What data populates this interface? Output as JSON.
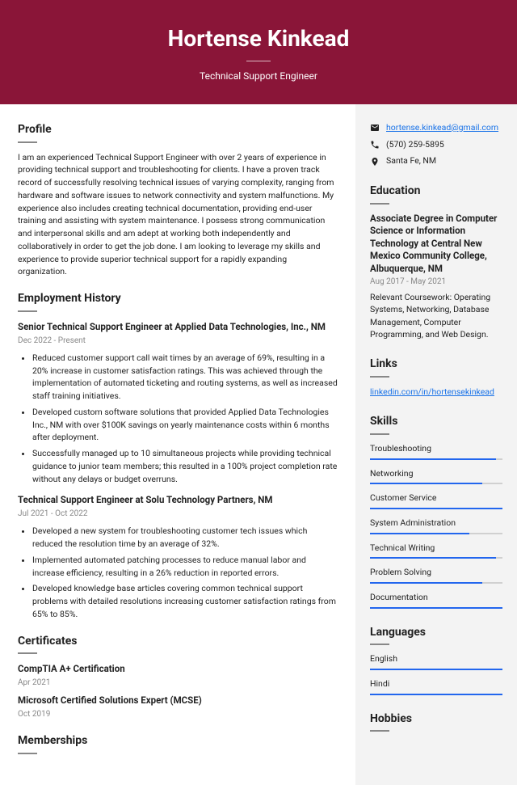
{
  "header": {
    "name": "Hortense Kinkead",
    "title": "Technical Support Engineer"
  },
  "profile": {
    "heading": "Profile",
    "text": "I am an experienced Technical Support Engineer with over 2 years of experience in providing technical support and troubleshooting for clients. I have a proven track record of successfully resolving technical issues of varying complexity, ranging from hardware and software issues to network connectivity and system malfunctions. My experience also includes creating technical documentation, providing end-user training and assisting with system maintenance. I possess strong communication and interpersonal skills and am adept at working both independently and collaboratively in order to get the job done. I am looking to leverage my skills and experience to provide superior technical support for a rapidly expanding organization."
  },
  "employment": {
    "heading": "Employment History",
    "jobs": [
      {
        "title": "Senior Technical Support Engineer at Applied Data Technologies, Inc., NM",
        "dates": "Dec 2022 - Present",
        "bullets": [
          "Reduced customer support call wait times by an average of 69%, resulting in a 20% increase in customer satisfaction ratings. This was achieved through the implementation of automated ticketing and routing systems, as well as increased staff training initiatives.",
          "Developed custom software solutions that provided Applied Data Technologies Inc., NM with over $100K savings on yearly maintenance costs within 6 months after deployment.",
          "Successfully managed up to 10 simultaneous projects while providing technical guidance to junior team members; this resulted in a 100% project completion rate without any delays or budget overruns."
        ]
      },
      {
        "title": "Technical Support Engineer at Solu Technology Partners, NM",
        "dates": "Jul 2021 - Oct 2022",
        "bullets": [
          "Developed a new system for troubleshooting customer tech issues which reduced the resolution time by an average of 32%.",
          "Implemented automated patching processes to reduce manual labor and increase efficiency, resulting in a 26% reduction in reported errors.",
          "Developed knowledge base articles covering common technical support problems with detailed resolutions increasing customer satisfaction ratings from 65% to 85%."
        ]
      }
    ]
  },
  "certificates": {
    "heading": "Certificates",
    "items": [
      {
        "title": "CompTIA A+ Certification",
        "date": "Apr 2021"
      },
      {
        "title": "Microsoft Certified Solutions Expert (MCSE)",
        "date": "Oct 2019"
      }
    ]
  },
  "memberships": {
    "heading": "Memberships"
  },
  "contact": {
    "email": "hortense.kinkead@gmail.com",
    "phone": "(570) 259-5895",
    "location": "Santa Fe, NM"
  },
  "education": {
    "heading": "Education",
    "title": "Associate Degree in Computer Science or Information Technology at Central New Mexico Community College, Albuquerque, NM",
    "dates": "Aug 2017 - May 2021",
    "desc": "Relevant Coursework: Operating Systems, Networking, Database Management, Computer Programming, and Web Design."
  },
  "links": {
    "heading": "Links",
    "text": "linkedin.com/in/hortensekinkead"
  },
  "skills": {
    "heading": "Skills",
    "items": [
      {
        "name": "Troubleshooting",
        "pct": 95
      },
      {
        "name": "Networking",
        "pct": 85
      },
      {
        "name": "Customer Service",
        "pct": 100
      },
      {
        "name": "System Administration",
        "pct": 75
      },
      {
        "name": "Technical Writing",
        "pct": 95
      },
      {
        "name": "Problem Solving",
        "pct": 85
      },
      {
        "name": "Documentation",
        "pct": 100
      }
    ]
  },
  "languages": {
    "heading": "Languages",
    "items": [
      {
        "name": "English",
        "pct": 100
      },
      {
        "name": "Hindi",
        "pct": 100
      }
    ]
  },
  "hobbies": {
    "heading": "Hobbies"
  }
}
